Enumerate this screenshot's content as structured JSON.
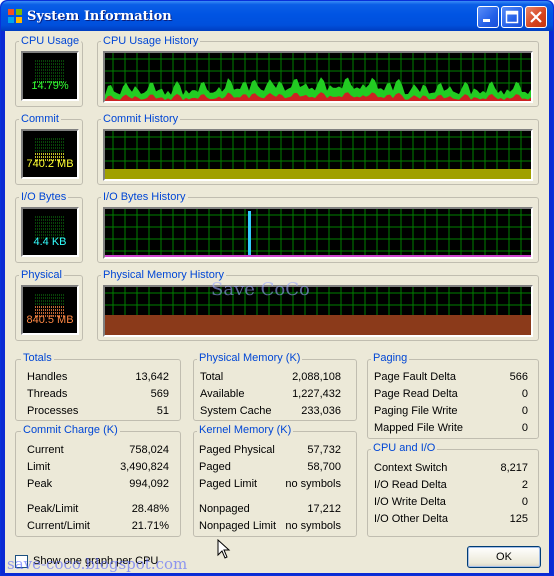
{
  "window": {
    "title": "System Information",
    "icon": "system-info-icon"
  },
  "meters": [
    {
      "label": "CPU Usage",
      "value": "14.79%",
      "color": "#33ff33",
      "fill": 0.1479
    },
    {
      "label": "Commit",
      "value": "740.2 MB",
      "color": "#ffff33",
      "fill": 0.45
    },
    {
      "label": "I/O Bytes",
      "value": "4.4  KB",
      "color": "#33ffff",
      "fill": 0.0
    },
    {
      "label": "Physical",
      "value": "840.5 MB",
      "color": "#ff8844",
      "fill": 0.6
    }
  ],
  "history": [
    {
      "label": "CPU Usage History"
    },
    {
      "label": "Commit History"
    },
    {
      "label": "I/O Bytes History"
    },
    {
      "label": "Physical Memory History"
    }
  ],
  "totals": {
    "title": "Totals",
    "rows": [
      {
        "label": "Handles",
        "value": "13,642"
      },
      {
        "label": "Threads",
        "value": "569"
      },
      {
        "label": "Processes",
        "value": "51"
      }
    ]
  },
  "physical_memory": {
    "title": "Physical Memory  (K)",
    "rows": [
      {
        "label": "Total",
        "value": "2,088,108"
      },
      {
        "label": "Available",
        "value": "1,227,432"
      },
      {
        "label": "System Cache",
        "value": "233,036"
      }
    ]
  },
  "paging": {
    "title": "Paging",
    "rows": [
      {
        "label": "Page Fault Delta",
        "value": "566"
      },
      {
        "label": "Page Read Delta",
        "value": "0"
      },
      {
        "label": "Paging File Write",
        "value": "0"
      },
      {
        "label": "Mapped File Write",
        "value": "0"
      }
    ]
  },
  "commit_charge": {
    "title": "Commit Charge  (K)",
    "rows": [
      {
        "label": "Current",
        "value": "758,024"
      },
      {
        "label": "Limit",
        "value": "3,490,824"
      },
      {
        "label": "Peak",
        "value": "994,092"
      },
      {
        "label": "Peak/Limit",
        "value": "28.48%"
      },
      {
        "label": "Current/Limit",
        "value": "21.71%"
      }
    ]
  },
  "kernel_memory": {
    "title": "Kernel Memory  (K)",
    "rows": [
      {
        "label": "Paged Physical",
        "value": "57,732"
      },
      {
        "label": "Paged",
        "value": "58,700"
      },
      {
        "label": "Paged Limit",
        "value": "no symbols"
      },
      {
        "label": "Nonpaged",
        "value": "17,212"
      },
      {
        "label": "Nonpaged Limit",
        "value": "no symbols"
      }
    ]
  },
  "cpu_io": {
    "title": "CPU and I/O",
    "rows": [
      {
        "label": "Context Switch",
        "value": "8,217"
      },
      {
        "label": "I/O Read Delta",
        "value": "2"
      },
      {
        "label": "I/O Write Delta",
        "value": "0"
      },
      {
        "label": "I/O Other Delta",
        "value": "125"
      }
    ]
  },
  "footer": {
    "checkbox_label": "Show one graph per CPU",
    "checkbox_checked": false,
    "ok_label": "OK"
  },
  "watermarks": [
    "Save CoCo",
    "save-coco.blogspot.com"
  ]
}
